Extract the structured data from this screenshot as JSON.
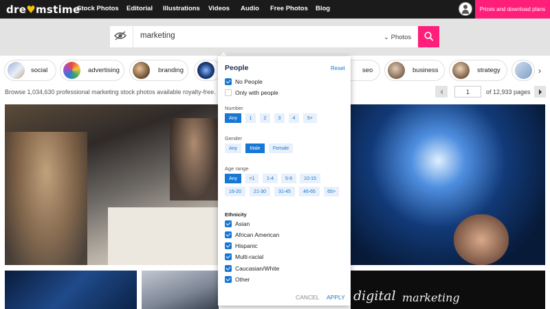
{
  "nav": {
    "logo_pre": "dre",
    "logo_post": "mstime",
    "items": [
      "Stock Photos",
      "Editorial",
      "Illustrations",
      "Videos",
      "Audio",
      "Free Photos",
      "Blog"
    ],
    "avatar_icon": "user-avatar-icon",
    "prices_label": "Prices and download plans"
  },
  "search": {
    "value": "marketing",
    "type_selected": "Photos",
    "icon": "search-icon",
    "filter_icon": "eye-icon"
  },
  "tags": [
    "social",
    "advertising",
    "branding",
    "seo",
    "business",
    "strategy"
  ],
  "browse": {
    "text": "Browse 1,034,630 professional marketing stock photos available royalty-free.",
    "page_value": "1",
    "page_total": "of 12,933 pages"
  },
  "popover": {
    "title": "People",
    "reset": "Reset",
    "no_people": "No People",
    "only_with_people": "Only with people",
    "no_people_checked": true,
    "only_with_people_checked": false,
    "number": {
      "title": "Number",
      "options": [
        "Any",
        "1",
        "2",
        "3",
        "4",
        "5+"
      ],
      "selected": "Any"
    },
    "gender": {
      "title": "Gender",
      "options": [
        "Any",
        "Male",
        "Female"
      ],
      "selected": "Male"
    },
    "age": {
      "title": "Age range",
      "options": [
        "Any",
        "<1",
        "1-4",
        "5-9",
        "10-15",
        "16-20",
        "21-30",
        "31-45",
        "46-65",
        "65>"
      ],
      "selected": "Any"
    },
    "ethnicity": {
      "title": "Ethnicity",
      "options": [
        "Asian",
        "African American",
        "Hispanic",
        "Multi-racial",
        "Caucasian/White",
        "Other"
      ],
      "all_checked": true
    },
    "cancel": "CANCEL",
    "apply": "APPLY"
  },
  "images": {
    "bottom_right_text_1": "digital",
    "bottom_right_text_2": "marketing"
  },
  "colors": {
    "accent_pink": "#ff1f7b",
    "accent_blue": "#1677d4",
    "nav_bg": "#1b1b1b"
  }
}
